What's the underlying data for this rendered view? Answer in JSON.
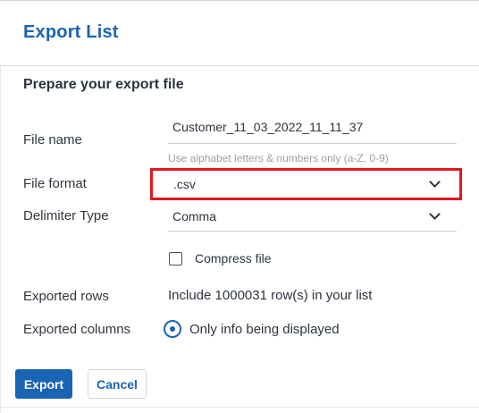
{
  "dialog": {
    "title": "Export List",
    "section_title": "Prepare your export file"
  },
  "form": {
    "file_name_label": "File name",
    "file_name_value": "Customer_11_03_2022_11_11_37",
    "file_name_hint": "Use alphabet letters & numbers only (a-Z, 0-9)",
    "file_format_label": "File format",
    "file_format_value": ".csv",
    "delimiter_label": "Delimiter Type",
    "delimiter_value": "Comma",
    "compress_label": "Compress file",
    "compress_checked": false,
    "exported_rows_label": "Exported rows",
    "exported_rows_value": "Include 1000031 row(s) in your list",
    "exported_columns_label": "Exported columns",
    "exported_columns_option": "Only info being displayed",
    "exported_columns_selected": true
  },
  "buttons": {
    "export_label": "Export",
    "cancel_label": "Cancel"
  },
  "colors": {
    "accent": "#1a64b4",
    "highlight": "#e4161c"
  },
  "icons": {
    "dropdown": "chevron-down-icon",
    "checkbox": "checkbox-icon",
    "radio": "radio-selected-icon"
  }
}
